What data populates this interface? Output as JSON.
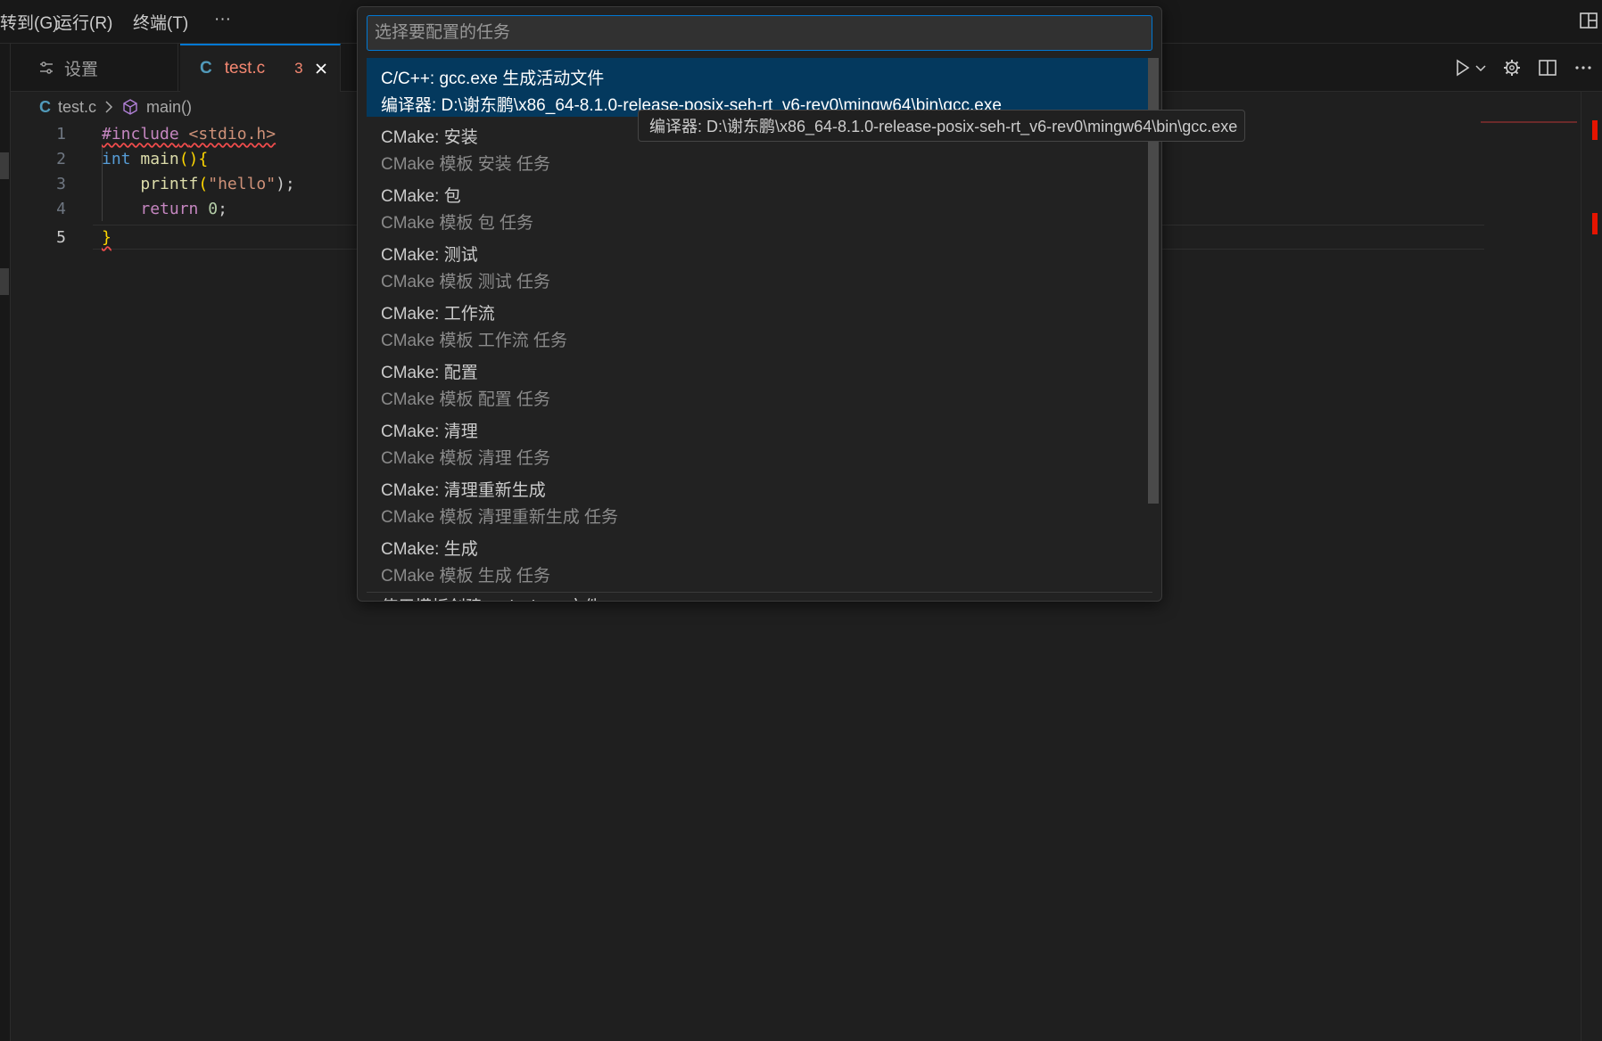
{
  "menu": {
    "items": [
      "转到(G)",
      "运行(R)",
      "终端(T)",
      "···"
    ]
  },
  "tabs": {
    "settings_label": "设置",
    "active_file_badge": "C",
    "active_file_name": "test.c",
    "active_file_problems": "3"
  },
  "breadcrumb": {
    "file_badge": "C",
    "file": "test.c",
    "symbol": "main()"
  },
  "editor": {
    "lines": [
      {
        "num": "1"
      },
      {
        "num": "2"
      },
      {
        "num": "3"
      },
      {
        "num": "4"
      },
      {
        "num": "5"
      }
    ],
    "code": {
      "l1_directive": "#include",
      "l1_header": "<stdio.h>",
      "l2_type": "int",
      "l2_fn": "main",
      "l2_paren": "()",
      "l2_brace": "{",
      "l3_fn": "printf",
      "l3_open": "(",
      "l3_str": "\"hello\"",
      "l3_close": ");",
      "l4_kw": "return",
      "l4_num": "0",
      "l4_semi": ";",
      "l5_brace": "}"
    }
  },
  "quick_pick": {
    "placeholder": "选择要配置的任务",
    "items": [
      {
        "label": "C/C++: gcc.exe 生成活动文件",
        "desc": "编译器: D:\\谢东鹏\\x86_64-8.1.0-release-posix-seh-rt_v6-rev0\\mingw64\\bin\\gcc.exe"
      },
      {
        "label": "CMake: 安装",
        "desc": "CMake 模板 安装 任务"
      },
      {
        "label": "CMake: 包",
        "desc": "CMake 模板 包 任务"
      },
      {
        "label": "CMake: 测试",
        "desc": "CMake 模板 测试 任务"
      },
      {
        "label": "CMake: 工作流",
        "desc": "CMake 模板 工作流 任务"
      },
      {
        "label": "CMake: 配置",
        "desc": "CMake 模板 配置 任务"
      },
      {
        "label": "CMake: 清理",
        "desc": "CMake 模板 清理 任务"
      },
      {
        "label": "CMake: 清理重新生成",
        "desc": "CMake 模板 清理重新生成 任务"
      },
      {
        "label": "CMake: 生成",
        "desc": "CMake 模板 生成 任务"
      }
    ],
    "cut_item_label": "使用模板创建 tasks.json 文件"
  },
  "tooltip": {
    "text": "编译器: D:\\谢东鹏\\x86_64-8.1.0-release-posix-seh-rt_v6-rev0\\mingw64\\bin\\gcc.exe"
  },
  "colors": {
    "accent": "#0078d4",
    "selection": "#04395e",
    "error": "#f48771"
  }
}
